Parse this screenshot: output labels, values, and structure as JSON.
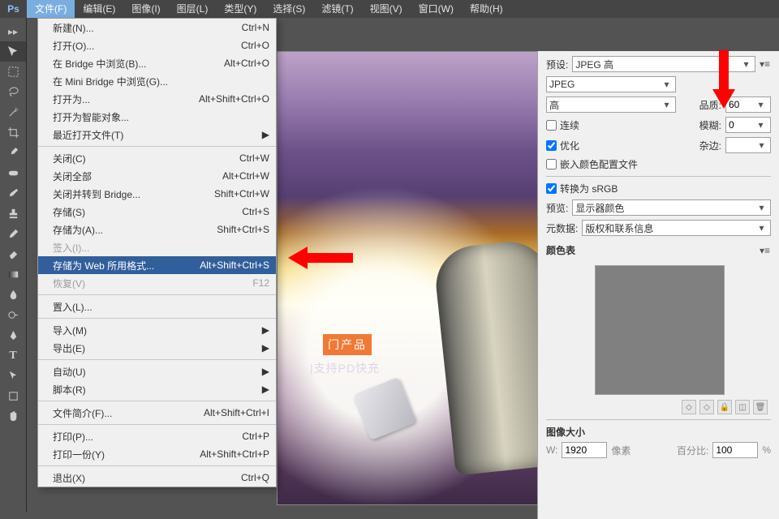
{
  "menubar": [
    "文件(F)",
    "编辑(E)",
    "图像(I)",
    "图层(L)",
    "类型(Y)",
    "选择(S)",
    "滤镜(T)",
    "视图(V)",
    "窗口(W)",
    "帮助(H)"
  ],
  "logo": "Ps",
  "file_menu": [
    {
      "l": "新建(N)...",
      "s": "Ctrl+N"
    },
    {
      "l": "打开(O)...",
      "s": "Ctrl+O"
    },
    {
      "l": "在 Bridge 中浏览(B)...",
      "s": "Alt+Ctrl+O"
    },
    {
      "l": "在 Mini Bridge 中浏览(G)..."
    },
    {
      "l": "打开为...",
      "s": "Alt+Shift+Ctrl+O"
    },
    {
      "l": "打开为智能对象..."
    },
    {
      "l": "最近打开文件(T)",
      "sub": true
    },
    {
      "sep": true
    },
    {
      "l": "关闭(C)",
      "s": "Ctrl+W"
    },
    {
      "l": "关闭全部",
      "s": "Alt+Ctrl+W"
    },
    {
      "l": "关闭并转到 Bridge...",
      "s": "Shift+Ctrl+W"
    },
    {
      "l": "存储(S)",
      "s": "Ctrl+S"
    },
    {
      "l": "存储为(A)...",
      "s": "Shift+Ctrl+S"
    },
    {
      "l": "签入(I)...",
      "disabled": true
    },
    {
      "l": "存储为 Web 所用格式...",
      "s": "Alt+Shift+Ctrl+S",
      "hl": true
    },
    {
      "l": "恢复(V)",
      "s": "F12",
      "disabled": true
    },
    {
      "sep": true
    },
    {
      "l": "置入(L)..."
    },
    {
      "sep": true
    },
    {
      "l": "导入(M)",
      "sub": true
    },
    {
      "l": "导出(E)",
      "sub": true
    },
    {
      "sep": true
    },
    {
      "l": "自动(U)",
      "sub": true
    },
    {
      "l": "脚本(R)",
      "sub": true
    },
    {
      "sep": true
    },
    {
      "l": "文件简介(F)...",
      "s": "Alt+Shift+Ctrl+I"
    },
    {
      "sep": true
    },
    {
      "l": "打印(P)...",
      "s": "Ctrl+P"
    },
    {
      "l": "打印一份(Y)",
      "s": "Alt+Shift+Ctrl+P"
    },
    {
      "sep": true
    },
    {
      "l": "退出(X)",
      "s": "Ctrl+Q"
    }
  ],
  "panel": {
    "preset_lbl": "预设:",
    "preset_val": "JPEG 高",
    "format_val": "JPEG",
    "quality_preset": "高",
    "quality_lbl": "品质:",
    "quality_val": "60",
    "progressive": "连续",
    "optimized": "优化",
    "embed_profile": "嵌入颜色配置文件",
    "blur_lbl": "模糊:",
    "blur_val": "0",
    "matte_lbl": "杂边:",
    "convert_srgb": "转换为 sRGB",
    "preview_lbl": "预览:",
    "preview_val": "显示器颜色",
    "metadata_lbl": "元数据:",
    "metadata_val": "版权和联系信息",
    "colortable": "颜色表",
    "imagesize": "图像大小",
    "w_lbl": "W:",
    "w_val": "1920",
    "unit": "像素",
    "pct_lbl": "百分比:",
    "pct_val": "100",
    "pct_unit": "%"
  },
  "preview": {
    "badge": "门产品",
    "subtitle": "|支持PD快充"
  }
}
